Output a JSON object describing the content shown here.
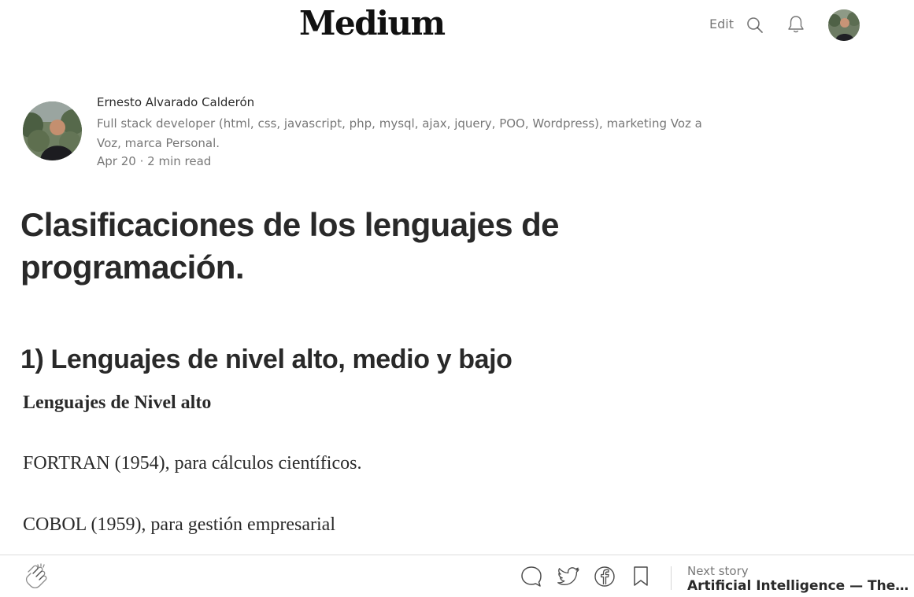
{
  "header": {
    "logo": "Medium",
    "edit_label": "Edit",
    "search_icon": "search-icon",
    "notifications_icon": "bell-icon",
    "user_avatar": "avatar"
  },
  "author": {
    "name": "Ernesto Alvarado Calderón",
    "bio": "Full stack developer (html, css, javascript, php, mysql, ajax, jquery, POO, Wordpress), marketing Voz a Voz, marca Personal.",
    "date": "Apr 20",
    "separator": "·",
    "read_time": "2 min read"
  },
  "article": {
    "title": "Clasificaciones de los lenguajes de programación.",
    "section_heading": "1) Lenguajes de nivel alto, medio y bajo",
    "subheading": "Lenguajes de Nivel alto",
    "paragraphs": [
      "FORTRAN (1954), para cálculos científicos.",
      "COBOL (1959), para gestión empresarial"
    ]
  },
  "bottom_bar": {
    "icons": [
      "clap-icon",
      "response-icon",
      "twitter-icon",
      "facebook-icon",
      "bookmark-icon"
    ],
    "next_story_label": "Next story",
    "next_story_title": "Artificial Intelligence — The Rise of Intelligent Machines"
  },
  "colors": {
    "text_primary": "#292929",
    "text_secondary": "#757575",
    "background": "#ffffff",
    "divider": "#dcdcdc"
  }
}
